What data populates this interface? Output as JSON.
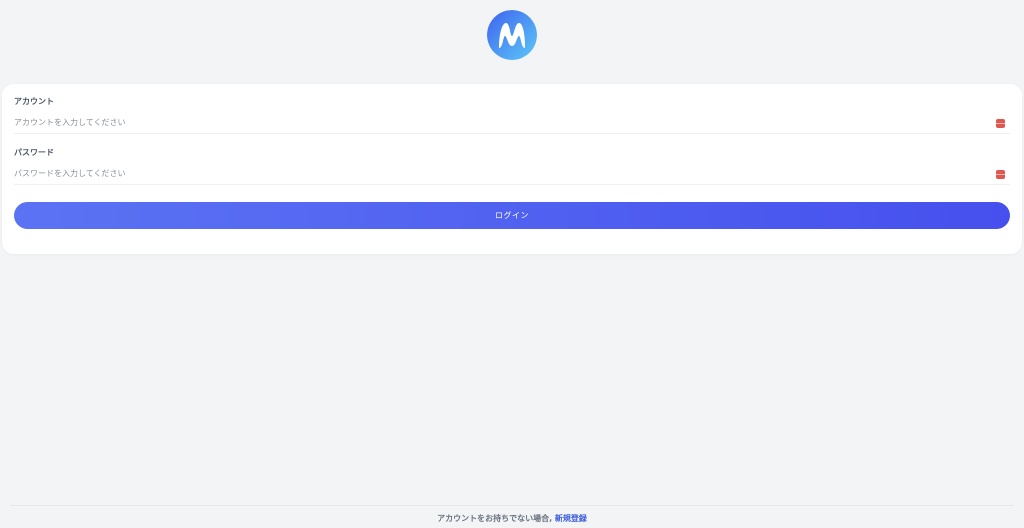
{
  "logo": {
    "icon": "m-logo-icon",
    "colors": [
      "#3f63f0",
      "#5cc8f7"
    ]
  },
  "account": {
    "label": "アカウント",
    "placeholder": "アカウントを入力してください",
    "value": ""
  },
  "password": {
    "label": "パスワード",
    "placeholder": "パスワードを入力してください",
    "value": ""
  },
  "login_button": {
    "label": "ログイン",
    "color": "#4a5cf0"
  },
  "footer": {
    "text": "アカウントをお持ちでない場合,",
    "link_label": "新規登録",
    "link_color": "#3b5bdb"
  }
}
